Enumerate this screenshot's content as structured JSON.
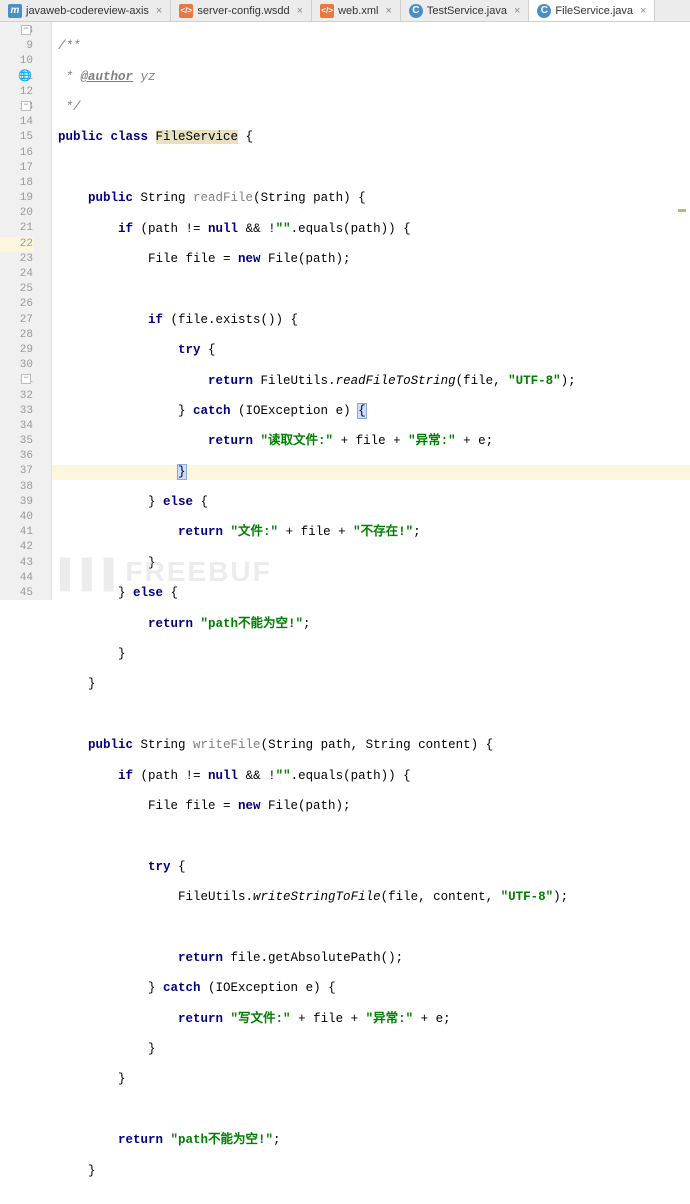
{
  "tabs": [
    {
      "label": "javaweb-codereview-axis",
      "icon": "m"
    },
    {
      "label": "server-config.wsdd",
      "icon": "xml"
    },
    {
      "label": "web.xml",
      "icon": "xml"
    },
    {
      "label": "TestService.java",
      "icon": "c"
    },
    {
      "label": "FileService.java",
      "icon": "c",
      "active": true
    }
  ],
  "line_start": 8,
  "line_end": 45,
  "highlighted_line": 22,
  "code": {
    "l8": "/**",
    "l9a": " * ",
    "l9b": "@author",
    "l9c": " yz",
    "l10": " */",
    "l11a": "public class ",
    "l11b": "FileService",
    "l11c": " {",
    "l13a": "    ",
    "l13b": "public",
    "l13c": " String ",
    "l13d": "readFile",
    "l13e": "(String path) {",
    "l14a": "        ",
    "l14b": "if",
    "l14c": " (path != ",
    "l14d": "null",
    "l14e": " && !",
    "l14f": "\"\"",
    "l14g": ".equals(path)) {",
    "l15a": "            File file = ",
    "l15b": "new",
    "l15c": " File(path);",
    "l17a": "            ",
    "l17b": "if",
    "l17c": " (file.exists()) {",
    "l18a": "                ",
    "l18b": "try",
    "l18c": " {",
    "l19a": "                    ",
    "l19b": "return",
    "l19c": " FileUtils.",
    "l19d": "readFileToString",
    "l19e": "(file, ",
    "l19f": "\"UTF-8\"",
    "l19g": ");",
    "l20a": "                } ",
    "l20b": "catch",
    "l20c": " (IOException e) ",
    "l20d": "{",
    "l21a": "                    ",
    "l21b": "return ",
    "l21c": "\"读取文件:\"",
    "l21d": " + file + ",
    "l21e": "\"异常:\"",
    "l21f": " + e;",
    "l22a": "                ",
    "l22b": "}",
    "l23a": "            } ",
    "l23b": "else",
    "l23c": " {",
    "l24a": "                ",
    "l24b": "return ",
    "l24c": "\"文件:\"",
    "l24d": " + file + ",
    "l24e": "\"不存在!\"",
    "l24f": ";",
    "l25": "            }",
    "l26a": "        } ",
    "l26b": "else",
    "l26c": " {",
    "l27a": "            ",
    "l27b": "return ",
    "l27c": "\"path不能为空!\"",
    "l27d": ";",
    "l28": "        }",
    "l29": "    }",
    "l31a": "    ",
    "l31b": "public",
    "l31c": " String ",
    "l31d": "writeFile",
    "l31e": "(String path, String content) {",
    "l32a": "        ",
    "l32b": "if",
    "l32c": " (path != ",
    "l32d": "null",
    "l32e": " && !",
    "l32f": "\"\"",
    "l32g": ".equals(path)) {",
    "l33a": "            File file = ",
    "l33b": "new",
    "l33c": " File(path);",
    "l35a": "            ",
    "l35b": "try",
    "l35c": " {",
    "l36a": "                FileUtils.",
    "l36b": "writeStringToFile",
    "l36c": "(file, content, ",
    "l36d": "\"UTF-8\"",
    "l36e": ");",
    "l38a": "                ",
    "l38b": "return",
    "l38c": " file.getAbsolutePath();",
    "l39a": "            } ",
    "l39b": "catch",
    "l39c": " (IOException e) {",
    "l40a": "                ",
    "l40b": "return ",
    "l40c": "\"写文件:\"",
    "l40d": " + file + ",
    "l40e": "\"异常:\"",
    "l40f": " + e;",
    "l41": "            }",
    "l42": "        }",
    "l44a": "        ",
    "l44b": "return ",
    "l44c": "\"path不能为空!\"",
    "l44d": ";",
    "l45": "    }"
  },
  "watermark": "FREEBUF"
}
